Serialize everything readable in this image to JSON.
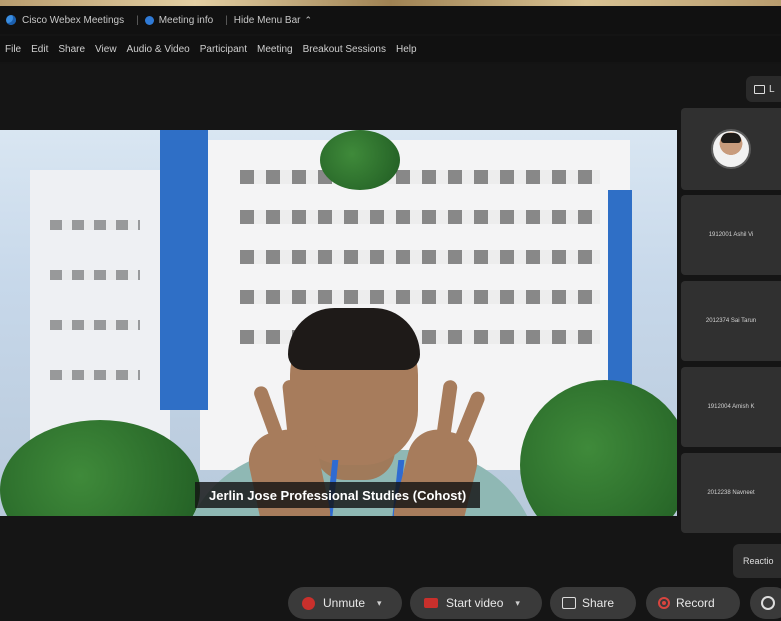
{
  "titlebar": {
    "app_name": "Cisco Webex Meetings",
    "meeting_info": "Meeting info",
    "hide_menu": "Hide Menu Bar"
  },
  "menu": [
    "File",
    "Edit",
    "Share",
    "View",
    "Audio & Video",
    "Participant",
    "Meeting",
    "Breakout Sessions",
    "Help"
  ],
  "layout_button": {
    "label": "L"
  },
  "main_video": {
    "name_label": "Jerlin Jose Professional Studies (Cohost)"
  },
  "side_tiles": [
    {
      "label": ""
    },
    {
      "label": "1912001 Ashil Vi"
    },
    {
      "label": "2012374 Sai Tarun"
    },
    {
      "label": "1912004 Amish K"
    },
    {
      "label": "2012238 Navneet"
    }
  ],
  "reactions": {
    "label": "Reactio"
  },
  "controls": {
    "unmute": "Unmute",
    "start_video": "Start video",
    "share": "Share",
    "record": "Record"
  },
  "colors": {
    "accent_red": "#c9302c",
    "tile_bg": "#303030",
    "bg": "#151515"
  }
}
